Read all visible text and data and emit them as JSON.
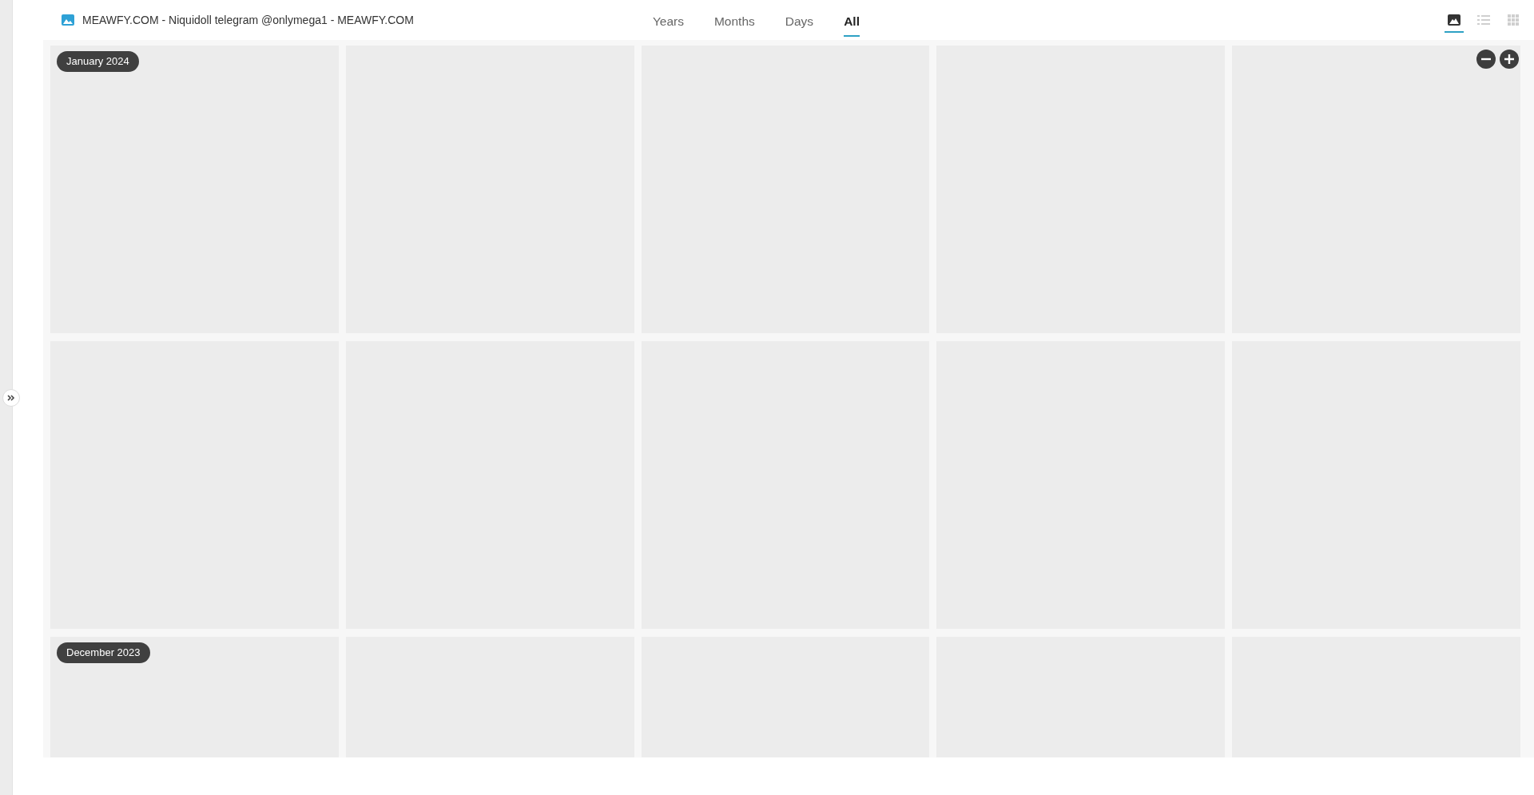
{
  "header": {
    "title": "MEAWFY.COM - Niquidoll telegram @onlymega1 - MEAWFY.COM"
  },
  "tabs": [
    {
      "label": "Years",
      "selected": false
    },
    {
      "label": "Months",
      "selected": false
    },
    {
      "label": "Days",
      "selected": false
    },
    {
      "label": "All",
      "selected": true
    }
  ],
  "view_modes": [
    {
      "kind": "photo",
      "selected": true
    },
    {
      "kind": "list",
      "selected": false
    },
    {
      "kind": "grid",
      "selected": false
    }
  ],
  "zoom_controls": [
    {
      "kind": "zoom-out"
    },
    {
      "kind": "zoom-in"
    }
  ],
  "sections": [
    {
      "label": "January 2024",
      "tiles": [
        {
          "kind": "placeholder"
        },
        {
          "kind": "placeholder"
        },
        {
          "kind": "placeholder"
        },
        {
          "kind": "placeholder"
        },
        {
          "kind": "placeholder"
        },
        {
          "kind": "placeholder"
        },
        {
          "kind": "placeholder"
        },
        {
          "kind": "placeholder"
        },
        {
          "kind": "placeholder"
        },
        {
          "kind": "placeholder"
        }
      ]
    },
    {
      "label": "December 2023",
      "tiles": [
        {
          "kind": "placeholder"
        },
        {
          "kind": "placeholder"
        },
        {
          "kind": "placeholder"
        },
        {
          "kind": "placeholder"
        },
        {
          "kind": "placeholder"
        }
      ]
    }
  ]
}
